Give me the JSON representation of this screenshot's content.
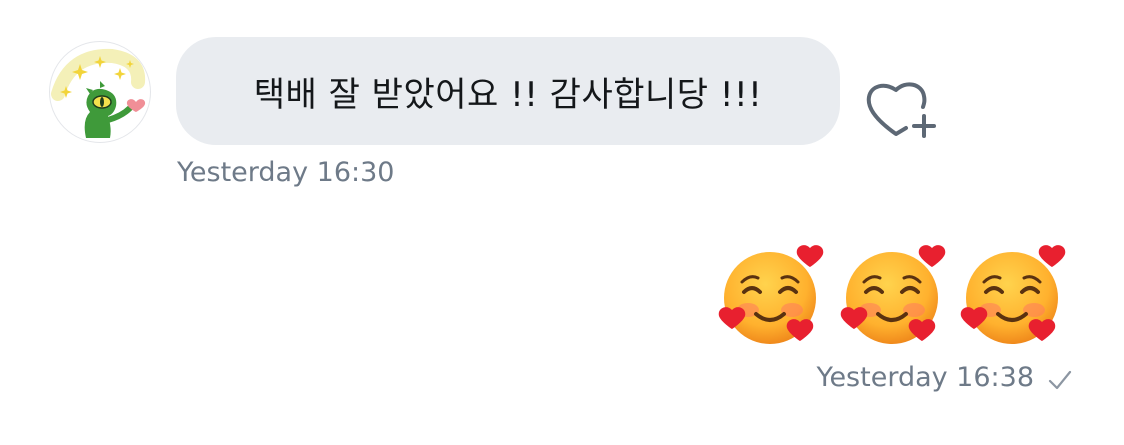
{
  "incoming": {
    "message_text": "택배 잘 받았어요 !! 감사합니당 !!!",
    "timestamp": "Yesterday 16:30",
    "avatar_icon": "green-monster-sticker-avatar"
  },
  "reaction": {
    "icon": "heart-plus-icon"
  },
  "outgoing": {
    "emojis": [
      "smiling-face-with-hearts",
      "smiling-face-with-hearts",
      "smiling-face-with-hearts"
    ],
    "timestamp": "Yesterday 16:38",
    "status_icon": "checkmark-icon"
  },
  "colors": {
    "bubble_bg": "#e9ecf0",
    "text": "#14171a",
    "meta_text": "#6e7a88",
    "icon": "#5d6875"
  }
}
